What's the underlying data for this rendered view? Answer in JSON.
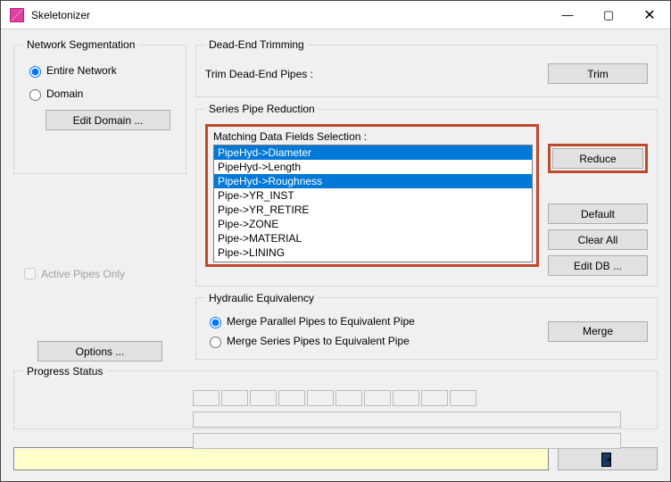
{
  "window": {
    "title": "Skeletonizer"
  },
  "network_segmentation": {
    "legend": "Network Segmentation",
    "entire_network": "Entire Network",
    "domain": "Domain",
    "edit_domain": "Edit Domain ...",
    "active_pipes_only": "Active Pipes Only",
    "selected": "entire_network"
  },
  "options_button": "Options ...",
  "dead_end": {
    "legend": "Dead-End Trimming",
    "label": "Trim Dead-End Pipes :",
    "button": "Trim"
  },
  "series": {
    "legend": "Series Pipe Reduction",
    "matching_label": "Matching Data Fields Selection :",
    "items": [
      {
        "label": "PipeHyd->Diameter",
        "selected": true
      },
      {
        "label": "PipeHyd->Length",
        "selected": false
      },
      {
        "label": "PipeHyd->Roughness",
        "selected": true
      },
      {
        "label": "Pipe->YR_INST",
        "selected": false
      },
      {
        "label": "Pipe->YR_RETIRE",
        "selected": false
      },
      {
        "label": "Pipe->ZONE",
        "selected": false
      },
      {
        "label": "Pipe->MATERIAL",
        "selected": false
      },
      {
        "label": "Pipe->LINING",
        "selected": false
      }
    ],
    "reduce": "Reduce",
    "default": "Default",
    "clear_all": "Clear All",
    "edit_db": "Edit DB ..."
  },
  "hydraulic": {
    "legend": "Hydraulic Equivalency",
    "merge_parallel": "Merge Parallel Pipes to Equivalent Pipe",
    "merge_series": "Merge Series Pipes to Equivalent Pipe",
    "selected": "parallel",
    "merge_button": "Merge"
  },
  "progress": {
    "legend": "Progress Status"
  }
}
